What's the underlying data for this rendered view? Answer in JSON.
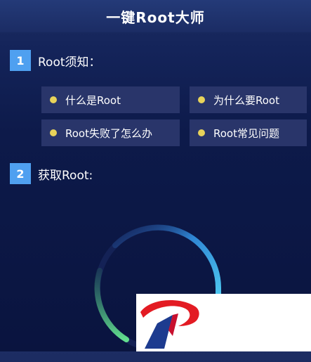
{
  "app": {
    "title": "一键Root大师"
  },
  "section1": {
    "number": "1",
    "title": "Root须知："
  },
  "faq": [
    {
      "label": "什么是Root"
    },
    {
      "label": "为什么要Root"
    },
    {
      "label": "Root失败了怎么办"
    },
    {
      "label": "Root常见问题"
    }
  ],
  "section2": {
    "number": "2",
    "title": "获取Root:"
  },
  "colors": {
    "background": "#0a143f",
    "header": "#1b2c64",
    "badge": "#4fa0f0",
    "card": "#29356a",
    "dot": "#e8d35a",
    "ring_blue": "#3fb8ea",
    "ring_green": "#5fd88a",
    "logo_red": "#e31b23",
    "logo_blue": "#1d3b8f"
  },
  "icons": {
    "progress": "circular-progress-ring",
    "watermark": "logo-icon"
  }
}
